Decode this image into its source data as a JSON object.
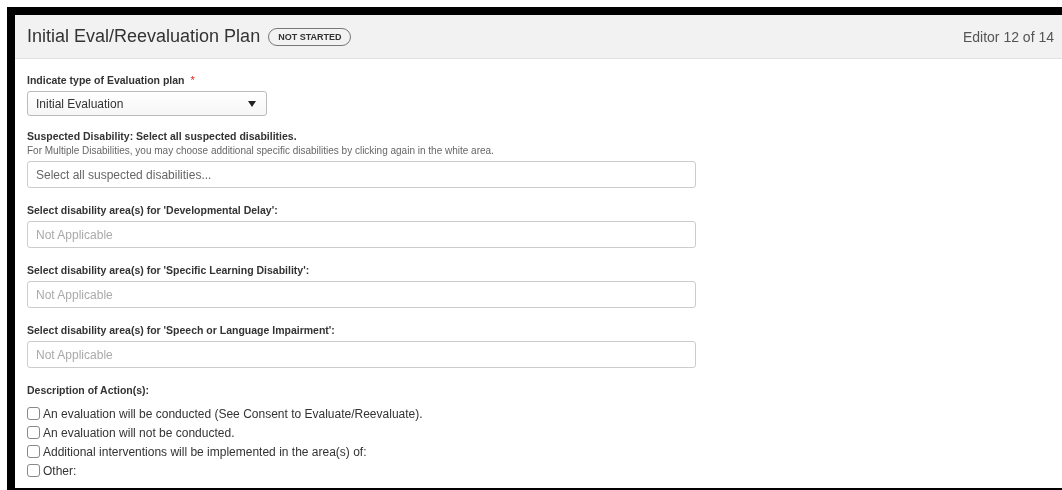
{
  "header": {
    "title": "Initial Eval/Reevaluation Plan",
    "status": "NOT STARTED",
    "editor_position": "Editor 12 of 14"
  },
  "plan_type": {
    "label": "Indicate type of Evaluation plan",
    "required_mark": "*",
    "value": "Initial Evaluation"
  },
  "suspected_disability": {
    "label": "Suspected Disability: Select all suspected disabilities.",
    "help": "For Multiple Disabilities, you may choose additional specific disabilities by clicking again in the white area.",
    "placeholder": "Select all suspected disabilities..."
  },
  "disability_areas": [
    {
      "label": "Select disability area(s) for 'Developmental Delay':",
      "placeholder": "Not Applicable"
    },
    {
      "label": "Select disability area(s) for 'Specific Learning Disability':",
      "placeholder": "Not Applicable"
    },
    {
      "label": "Select disability area(s) for 'Speech or Language Impairment':",
      "placeholder": "Not Applicable"
    }
  ],
  "actions": {
    "label": "Description of Action(s):",
    "options": [
      {
        "label": "An evaluation will be conducted (See Consent to Evaluate/Reevaluate).",
        "checked": false
      },
      {
        "label": "An evaluation will not be conducted.",
        "checked": false
      },
      {
        "label": "Additional interventions will be implemented in the area(s) of:",
        "checked": false
      },
      {
        "label": "Other:",
        "checked": false
      }
    ]
  }
}
